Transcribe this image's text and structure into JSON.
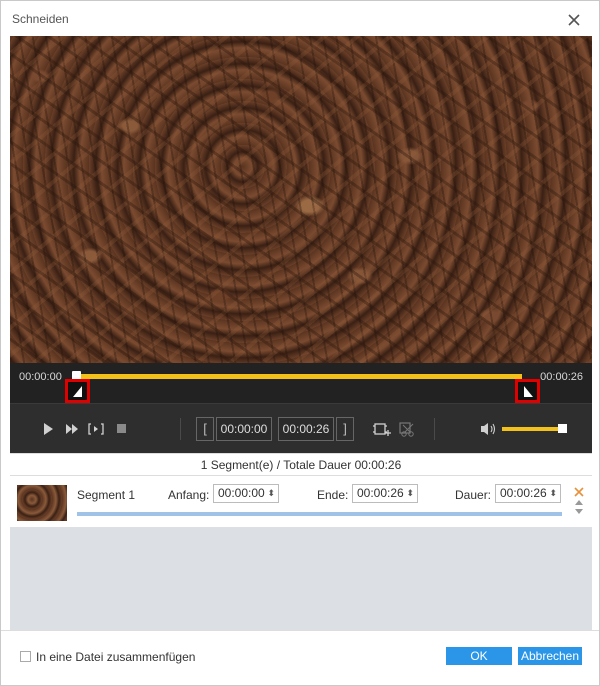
{
  "window": {
    "title": "Schneiden",
    "close_icon": "close-icon"
  },
  "timeline": {
    "start_time": "00:00:00",
    "end_time": "00:00:26",
    "accent_color": "#f2c21b",
    "handle_highlight_color": "#e10000"
  },
  "controls": {
    "icons": [
      "play-icon",
      "fast-forward-icon",
      "next-frame-icon",
      "stop-icon",
      "set-start-bracket-icon",
      "set-end-bracket-icon",
      "add-segment-icon",
      "split-segment-icon",
      "volume-icon"
    ],
    "start_value": "00:00:00",
    "end_value": "00:00:26",
    "volume_level": 0.95
  },
  "summary": {
    "text": "1 Segment(e) / Totale Dauer 00:00:26"
  },
  "segments": [
    {
      "name": "Segment 1",
      "start_label": "Anfang:",
      "start_value": "00:00:00",
      "end_label": "Ende:",
      "end_value": "00:00:26",
      "duration_label": "Dauer:",
      "duration_value": "00:00:26",
      "progress": 1.0
    }
  ],
  "footer": {
    "merge_label": "In eine Datei zusammenfügen",
    "merge_checked": false,
    "ok_label": "OK",
    "cancel_label": "Abbrechen",
    "button_color": "#2b96e8"
  }
}
